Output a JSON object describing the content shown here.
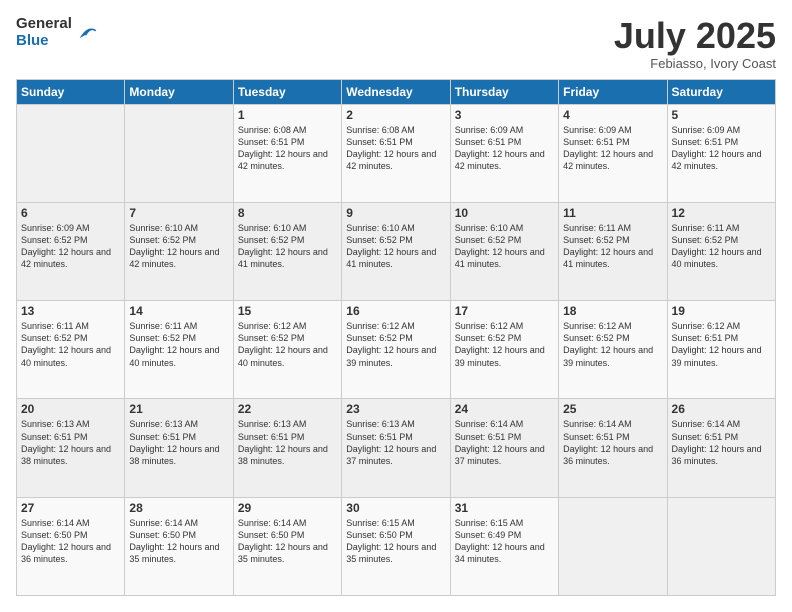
{
  "logo": {
    "general": "General",
    "blue": "Blue"
  },
  "title": "July 2025",
  "subtitle": "Febiasso, Ivory Coast",
  "days_of_week": [
    "Sunday",
    "Monday",
    "Tuesday",
    "Wednesday",
    "Thursday",
    "Friday",
    "Saturday"
  ],
  "weeks": [
    [
      {
        "day": "",
        "info": ""
      },
      {
        "day": "",
        "info": ""
      },
      {
        "day": "1",
        "info": "Sunrise: 6:08 AM\nSunset: 6:51 PM\nDaylight: 12 hours and 42 minutes."
      },
      {
        "day": "2",
        "info": "Sunrise: 6:08 AM\nSunset: 6:51 PM\nDaylight: 12 hours and 42 minutes."
      },
      {
        "day": "3",
        "info": "Sunrise: 6:09 AM\nSunset: 6:51 PM\nDaylight: 12 hours and 42 minutes."
      },
      {
        "day": "4",
        "info": "Sunrise: 6:09 AM\nSunset: 6:51 PM\nDaylight: 12 hours and 42 minutes."
      },
      {
        "day": "5",
        "info": "Sunrise: 6:09 AM\nSunset: 6:51 PM\nDaylight: 12 hours and 42 minutes."
      }
    ],
    [
      {
        "day": "6",
        "info": "Sunrise: 6:09 AM\nSunset: 6:52 PM\nDaylight: 12 hours and 42 minutes."
      },
      {
        "day": "7",
        "info": "Sunrise: 6:10 AM\nSunset: 6:52 PM\nDaylight: 12 hours and 42 minutes."
      },
      {
        "day": "8",
        "info": "Sunrise: 6:10 AM\nSunset: 6:52 PM\nDaylight: 12 hours and 41 minutes."
      },
      {
        "day": "9",
        "info": "Sunrise: 6:10 AM\nSunset: 6:52 PM\nDaylight: 12 hours and 41 minutes."
      },
      {
        "day": "10",
        "info": "Sunrise: 6:10 AM\nSunset: 6:52 PM\nDaylight: 12 hours and 41 minutes."
      },
      {
        "day": "11",
        "info": "Sunrise: 6:11 AM\nSunset: 6:52 PM\nDaylight: 12 hours and 41 minutes."
      },
      {
        "day": "12",
        "info": "Sunrise: 6:11 AM\nSunset: 6:52 PM\nDaylight: 12 hours and 40 minutes."
      }
    ],
    [
      {
        "day": "13",
        "info": "Sunrise: 6:11 AM\nSunset: 6:52 PM\nDaylight: 12 hours and 40 minutes."
      },
      {
        "day": "14",
        "info": "Sunrise: 6:11 AM\nSunset: 6:52 PM\nDaylight: 12 hours and 40 minutes."
      },
      {
        "day": "15",
        "info": "Sunrise: 6:12 AM\nSunset: 6:52 PM\nDaylight: 12 hours and 40 minutes."
      },
      {
        "day": "16",
        "info": "Sunrise: 6:12 AM\nSunset: 6:52 PM\nDaylight: 12 hours and 39 minutes."
      },
      {
        "day": "17",
        "info": "Sunrise: 6:12 AM\nSunset: 6:52 PM\nDaylight: 12 hours and 39 minutes."
      },
      {
        "day": "18",
        "info": "Sunrise: 6:12 AM\nSunset: 6:52 PM\nDaylight: 12 hours and 39 minutes."
      },
      {
        "day": "19",
        "info": "Sunrise: 6:12 AM\nSunset: 6:51 PM\nDaylight: 12 hours and 39 minutes."
      }
    ],
    [
      {
        "day": "20",
        "info": "Sunrise: 6:13 AM\nSunset: 6:51 PM\nDaylight: 12 hours and 38 minutes."
      },
      {
        "day": "21",
        "info": "Sunrise: 6:13 AM\nSunset: 6:51 PM\nDaylight: 12 hours and 38 minutes."
      },
      {
        "day": "22",
        "info": "Sunrise: 6:13 AM\nSunset: 6:51 PM\nDaylight: 12 hours and 38 minutes."
      },
      {
        "day": "23",
        "info": "Sunrise: 6:13 AM\nSunset: 6:51 PM\nDaylight: 12 hours and 37 minutes."
      },
      {
        "day": "24",
        "info": "Sunrise: 6:14 AM\nSunset: 6:51 PM\nDaylight: 12 hours and 37 minutes."
      },
      {
        "day": "25",
        "info": "Sunrise: 6:14 AM\nSunset: 6:51 PM\nDaylight: 12 hours and 36 minutes."
      },
      {
        "day": "26",
        "info": "Sunrise: 6:14 AM\nSunset: 6:51 PM\nDaylight: 12 hours and 36 minutes."
      }
    ],
    [
      {
        "day": "27",
        "info": "Sunrise: 6:14 AM\nSunset: 6:50 PM\nDaylight: 12 hours and 36 minutes."
      },
      {
        "day": "28",
        "info": "Sunrise: 6:14 AM\nSunset: 6:50 PM\nDaylight: 12 hours and 35 minutes."
      },
      {
        "day": "29",
        "info": "Sunrise: 6:14 AM\nSunset: 6:50 PM\nDaylight: 12 hours and 35 minutes."
      },
      {
        "day": "30",
        "info": "Sunrise: 6:15 AM\nSunset: 6:50 PM\nDaylight: 12 hours and 35 minutes."
      },
      {
        "day": "31",
        "info": "Sunrise: 6:15 AM\nSunset: 6:49 PM\nDaylight: 12 hours and 34 minutes."
      },
      {
        "day": "",
        "info": ""
      },
      {
        "day": "",
        "info": ""
      }
    ]
  ]
}
